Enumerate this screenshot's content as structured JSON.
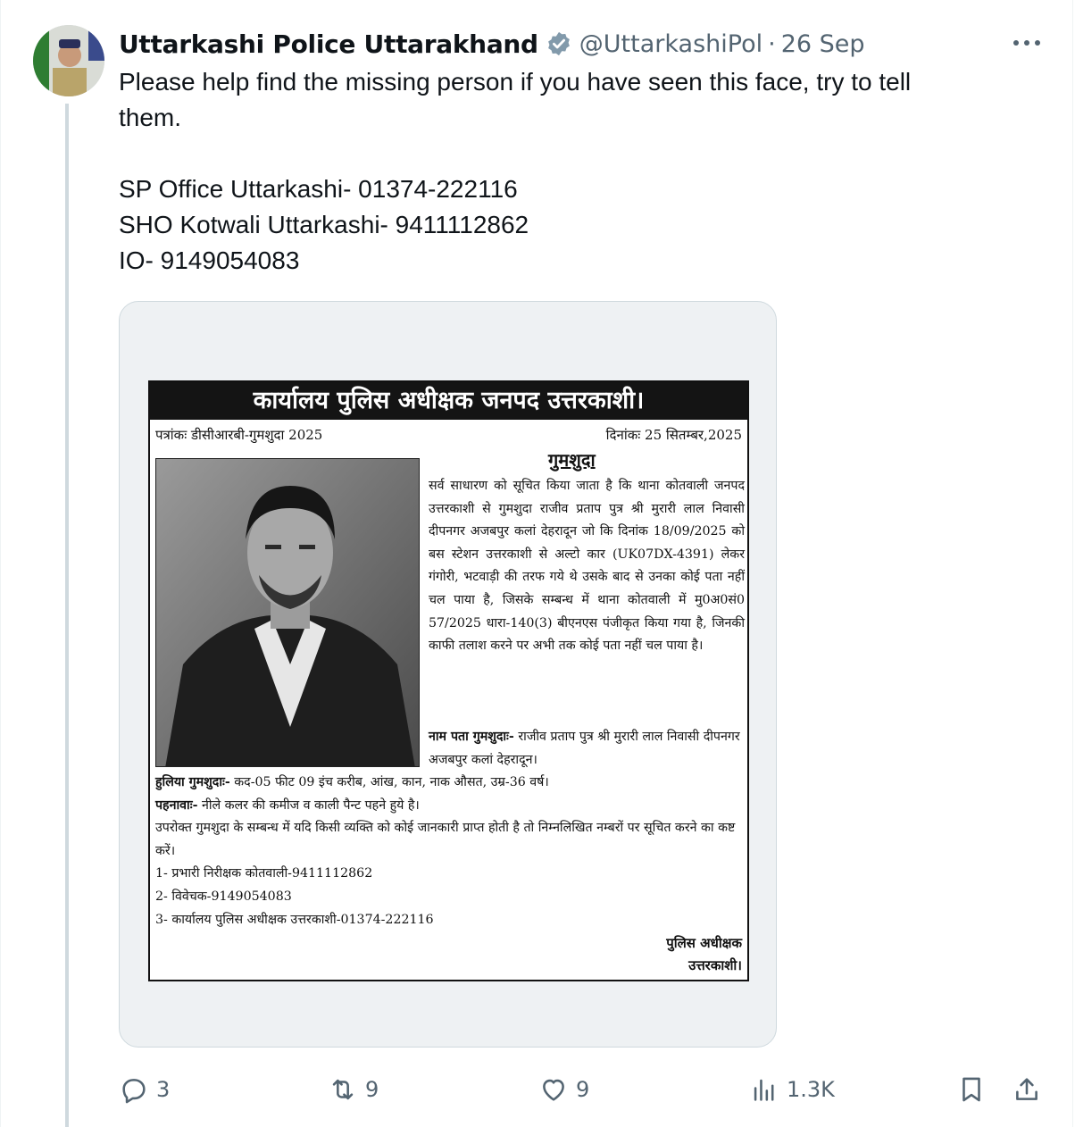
{
  "author": {
    "name": "Uttarkashi Police Uttarakhand",
    "handle": "@UttarkashiPol",
    "separator": "·",
    "date": "26 Sep"
  },
  "tweet": {
    "lines": [
      "Please help find the missing person if you have seen this face, try to tell",
      "them.",
      "",
      "SP Office Uttarkashi- 01374-222116",
      "SHO Kotwali Uttarkashi- 9411112862",
      "IO- 9149054083"
    ]
  },
  "notice": {
    "title": "कार्यालय पुलिस अधीक्षक जनपद उत्तरकाशी।",
    "ref": "पत्रांकः डीसीआरबी-गुमशुदा 2025",
    "date": "दिनांकः 25 सितम्बर,2025",
    "missing_heading": "गुमशुदा",
    "body": "सर्व साधारण को सूचित किया जाता है कि थाना कोतवाली जनपद उत्तरकाशी से गुमशुदा राजीव प्रताप पुत्र श्री मुरारी लाल निवासी दीपनगर अजबपुर कलां देहरादून जो कि दिनांक 18/09/2025 को बस स्टेशन उत्तरकाशी से अल्टो कार (UK07DX-4391) लेकर गंगोरी, भटवाड़ी की तरफ गये थे उसके बाद से उनका कोई पता नहीं चल पाया है, जिसके सम्बन्ध में थाना कोतवाली में मु0अ0सं0 57/2025 धारा-140(3) बीएनएस पंजीकृत किया गया है, जिनकी काफी तलाश करने पर अभी तक कोई पता नहीं चल पाया है।",
    "name_label": "नाम पता गुमशुदाः-",
    "name_value": "राजीव प्रताप पुत्र श्री मुरारी लाल निवासी दीपनगर अजबपुर कलां देहरादून।",
    "description_label": "हुलिया गुमशुदाः-",
    "description_value": "कद-05 फीट 09 इंच करीब, आंख, कान, नाक औसत, उम्र-36 वर्ष।",
    "clothing_label": "पहनावाः-",
    "clothing_value": "नीले कलर की कमीज व काली पैन्ट पहने हुये है।",
    "appeal": "उपरोक्त गुमशुदा के सम्बन्ध में यदि किसी व्यक्ति को कोई जानकारी प्राप्त होती है तो निम्नलिखित नम्बरों पर सूचित करने का कष्ट करें।",
    "contacts": [
      "1- प्रभारी निरीक्षक कोतवाली-9411112862",
      "2- विवेचक-9149054083",
      "3- कार्यालय पुलिस अधीक्षक उत्तरकाशी-01374-222116"
    ],
    "signature_line1": "पुलिस अधीक्षक",
    "signature_line2": "उत्तरकाशी।"
  },
  "actions": {
    "replies": "3",
    "reposts": "9",
    "likes": "9",
    "views": "1.3K"
  },
  "colors": {
    "text": "#0f1419",
    "secondary": "#536471",
    "verified_badge": "#829aab",
    "thread_line": "#cfd9de"
  },
  "icons": [
    "verified-badge-icon",
    "more-icon",
    "reply-icon",
    "repost-icon",
    "like-icon",
    "views-icon",
    "bookmark-icon",
    "share-icon"
  ]
}
